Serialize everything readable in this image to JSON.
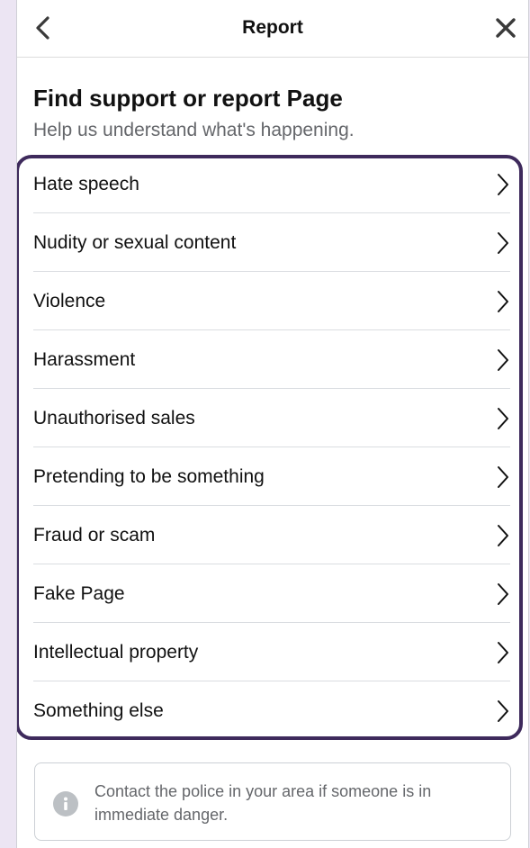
{
  "header": {
    "title": "Report",
    "back_icon": "chevron-left-icon",
    "close_icon": "close-icon"
  },
  "intro": {
    "heading": "Find support or report Page",
    "subheading": "Help us understand what's happening."
  },
  "options": [
    {
      "label": "Hate speech"
    },
    {
      "label": "Nudity or sexual content"
    },
    {
      "label": "Violence"
    },
    {
      "label": "Harassment"
    },
    {
      "label": "Unauthorised sales"
    },
    {
      "label": "Pretending to be something"
    },
    {
      "label": "Fraud or scam"
    },
    {
      "label": "Fake Page"
    },
    {
      "label": "Intellectual property"
    },
    {
      "label": "Something else"
    }
  ],
  "notice": {
    "icon": "info-icon",
    "text": "Contact the police in your area if someone is in immediate danger."
  },
  "colors": {
    "highlight_border": "#3e2a5c",
    "background": "#ece5f3",
    "text": "#111111",
    "secondary_text": "#65676b"
  }
}
